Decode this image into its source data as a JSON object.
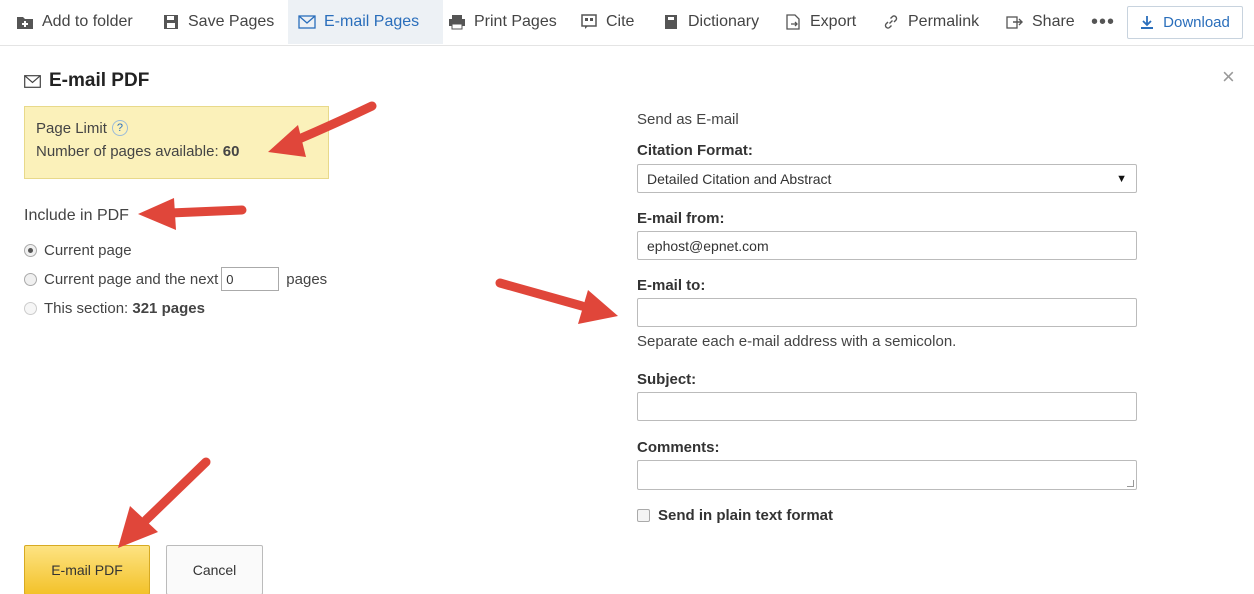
{
  "toolbar": {
    "items": [
      {
        "label": "Add to folder",
        "icon": "folder-add-icon"
      },
      {
        "label": "Save Pages",
        "icon": "save-icon"
      },
      {
        "label": "E-mail Pages",
        "icon": "envelope-icon"
      },
      {
        "label": "Print Pages",
        "icon": "printer-icon"
      },
      {
        "label": "Cite",
        "icon": "cite-icon"
      },
      {
        "label": "Dictionary",
        "icon": "dictionary-icon"
      },
      {
        "label": "Export",
        "icon": "export-icon"
      },
      {
        "label": "Permalink",
        "icon": "link-icon"
      },
      {
        "label": "Share",
        "icon": "share-icon"
      }
    ],
    "more": "•••",
    "download": "Download"
  },
  "dialog": {
    "title": "E-mail PDF",
    "close": "×",
    "limit": {
      "title": "Page Limit",
      "help": "?",
      "available_label": "Number of pages available:",
      "available_value": "60"
    },
    "include": {
      "label": "Include in PDF",
      "option_current": "Current page",
      "option_next_prefix": "Current page and the next",
      "option_next_value": "0",
      "option_next_suffix": "pages",
      "option_section_prefix": "This section:",
      "option_section_value": "321 pages"
    },
    "form": {
      "send_as": "Send as E-mail",
      "citation_label": "Citation Format:",
      "citation_value": "Detailed Citation and Abstract",
      "from_label": "E-mail from:",
      "from_value": "ephost@epnet.com",
      "to_label": "E-mail to:",
      "to_value": "",
      "to_hint": "Separate each e-mail address with a semicolon.",
      "subject_label": "Subject:",
      "subject_value": "",
      "comments_label": "Comments:",
      "comments_value": "",
      "plain_text_label": "Send in plain text format"
    },
    "buttons": {
      "submit": "E-mail PDF",
      "cancel": "Cancel"
    }
  },
  "colors": {
    "accent": "#2a6ebb",
    "limit_bg": "#fbf1ba",
    "primary_btn": "#f3c22a",
    "arrow": "#e0463a"
  }
}
